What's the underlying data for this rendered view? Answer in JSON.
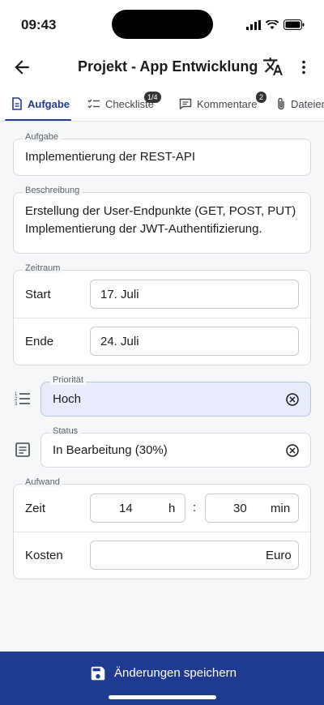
{
  "status_bar": {
    "time": "09:43"
  },
  "appbar": {
    "title": "Projekt - App Entwicklung",
    "back_icon": "arrow-left-icon",
    "translate_icon": "translate-icon",
    "more_icon": "more-vert-icon"
  },
  "tabs": [
    {
      "label": "Aufgabe",
      "icon": "document-icon",
      "active": true
    },
    {
      "label": "Checkliste",
      "icon": "checklist-icon",
      "badge": "1/4"
    },
    {
      "label": "Kommentare",
      "icon": "comment-icon",
      "badge": "2"
    },
    {
      "label": "Dateien",
      "icon": "paperclip-icon"
    }
  ],
  "task": {
    "label": "Aufgabe",
    "value": "Implementierung der REST-API"
  },
  "description": {
    "label": "Beschreibung",
    "line1": "Erstellung der User-Endpunkte (GET, POST, PUT)",
    "line2": "Implementierung der JWT-Authentifizierung."
  },
  "period": {
    "label": "Zeitraum",
    "start_label": "Start",
    "start_value": "17. Juli",
    "end_label": "Ende",
    "end_value": "24. Juli"
  },
  "priority": {
    "label": "Priorität",
    "value": "Hoch"
  },
  "status": {
    "label": "Status",
    "value": "In Bearbeitung (30%)"
  },
  "effort": {
    "label": "Aufwand",
    "time_label": "Zeit",
    "hours": "14",
    "hours_unit": "h",
    "separator": ":",
    "minutes": "30",
    "minutes_unit": "min",
    "cost_label": "Kosten",
    "cost_unit": "Euro"
  },
  "footer": {
    "save_label": "Änderungen speichern"
  },
  "colors": {
    "primary": "#1f3b8f",
    "priority_bg": "#e8ecfa"
  }
}
